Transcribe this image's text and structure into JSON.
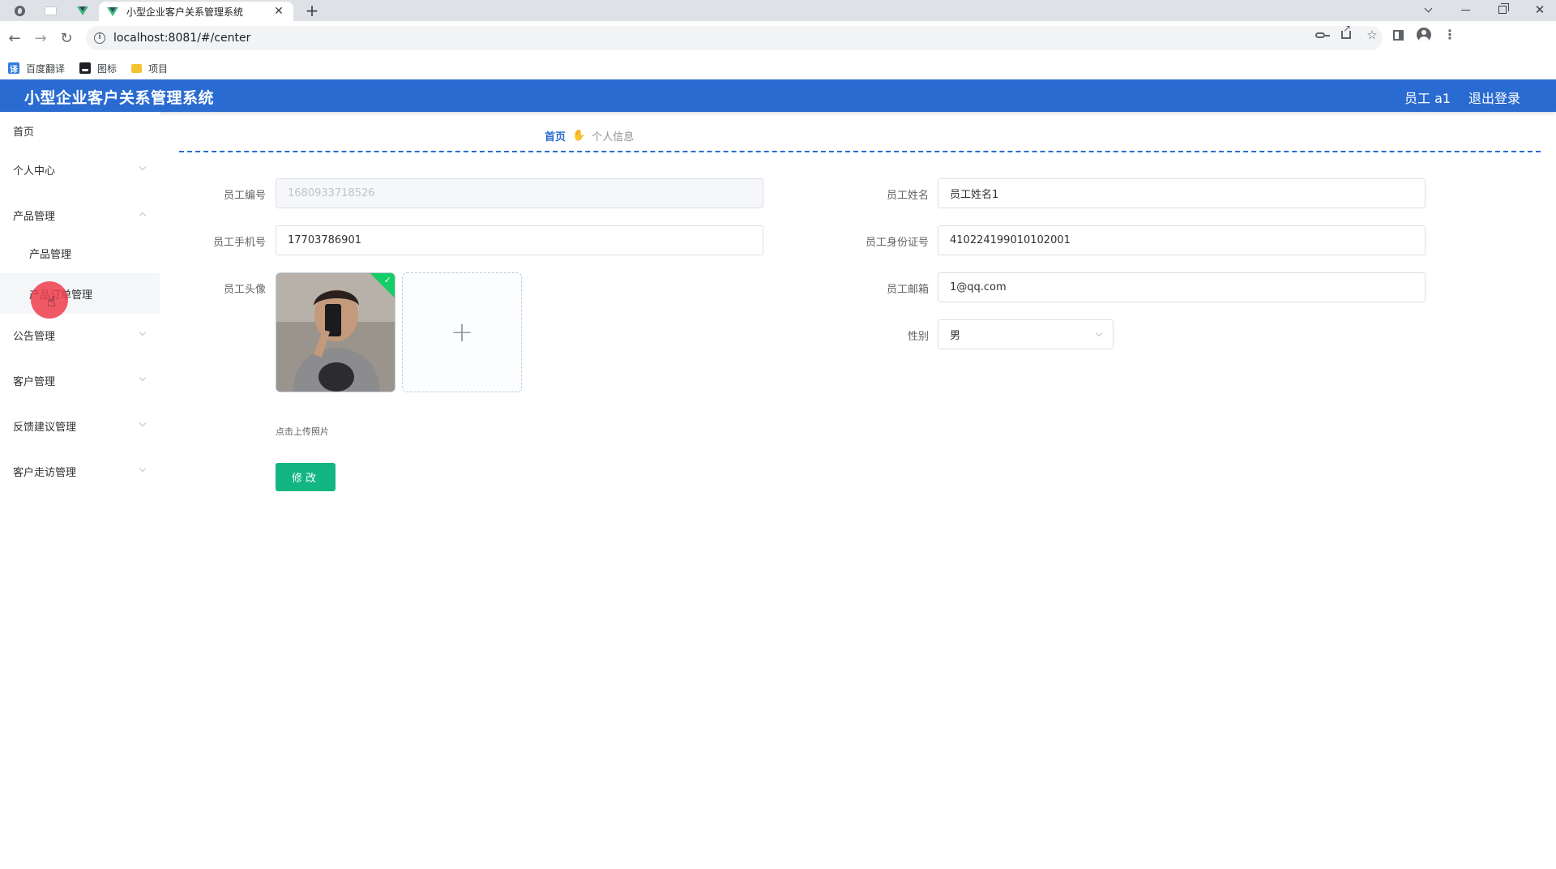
{
  "browser": {
    "tab_title": "小型企业客户关系管理系统",
    "tab_close": "✕",
    "new_tab": "+",
    "url": "localhost:8081/#/center",
    "info_glyph": "i",
    "bookmarks": [
      {
        "label": "百度翻译",
        "icon": "translate-icon",
        "glyph": "译"
      },
      {
        "label": "图标",
        "icon": "image-icon"
      },
      {
        "label": "项目",
        "icon": "folder-icon"
      }
    ]
  },
  "header": {
    "title": "小型企业客户关系管理系统",
    "user_label": "员工 a1",
    "logout": "退出登录",
    "background_color": "#2a6bd1"
  },
  "sidebar": {
    "items": [
      {
        "label": "首页"
      },
      {
        "label": "个人中心"
      },
      {
        "label": "产品管理",
        "expanded": true,
        "children": [
          "产品管理",
          "产品订单管理"
        ]
      },
      {
        "label": "公告管理"
      },
      {
        "label": "客户管理"
      },
      {
        "label": "反馈建议管理"
      },
      {
        "label": "客户走访管理"
      }
    ]
  },
  "breadcrumb": {
    "home": "首页",
    "current": "个人信息"
  },
  "form": {
    "employee_id": {
      "label": "员工编号",
      "value": "1680933718526"
    },
    "employee_name": {
      "label": "员工姓名",
      "value": "员工姓名1"
    },
    "phone": {
      "label": "员工手机号",
      "value": "17703786901"
    },
    "id_card": {
      "label": "员工身份证号",
      "value": "410224199010102001"
    },
    "avatar": {
      "label": "员工头像"
    },
    "email": {
      "label": "员工邮箱",
      "value": "1@qq.com"
    },
    "gender": {
      "label": "性别",
      "value": "男"
    },
    "upload_tip": "点击上传照片",
    "submit": "修改"
  },
  "colors": {
    "accent": "#2a6bd1",
    "success": "#13ce66",
    "button": "#13b583"
  }
}
